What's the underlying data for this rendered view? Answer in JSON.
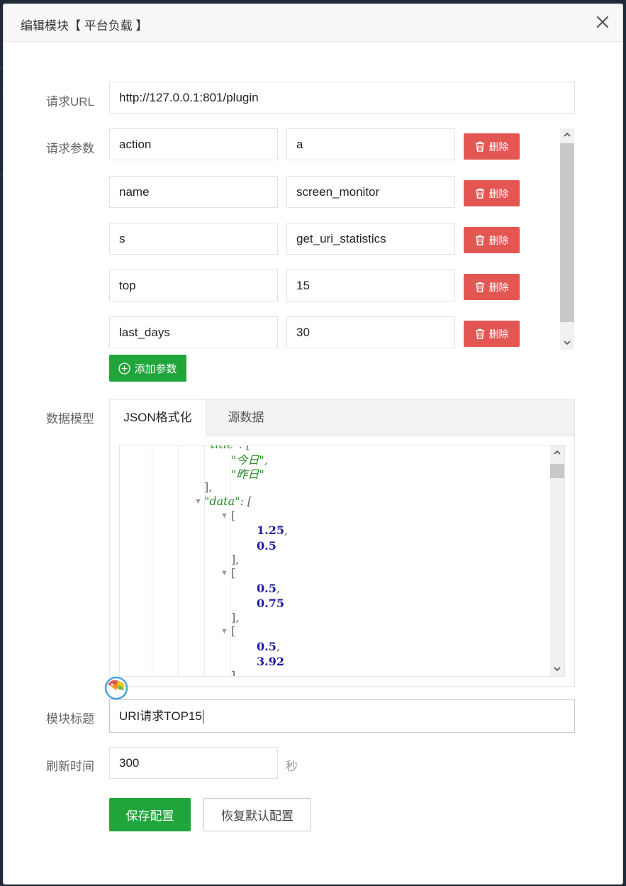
{
  "modal": {
    "title": "编辑模块【 平台负载 】",
    "close_icon": "close-icon"
  },
  "form": {
    "url_label": "请求URL",
    "url_value": "http://127.0.0.1:801/plugin",
    "params_label": "请求参数",
    "params": [
      {
        "key": "action",
        "value": "a"
      },
      {
        "key": "name",
        "value": "screen_monitor"
      },
      {
        "key": "s",
        "value": "get_uri_statistics"
      },
      {
        "key": "top",
        "value": "15"
      },
      {
        "key": "last_days",
        "value": "30"
      }
    ],
    "delete_label": "删除",
    "add_param_label": "添加参数",
    "model_label": "数据模型",
    "tabs": [
      {
        "label": "JSON格式化",
        "active": true
      },
      {
        "label": "源数据",
        "active": false
      }
    ],
    "json_lines": {
      "title_key": "title",
      "today": "\"今日\"",
      "yesterday": "\"昨日\"",
      "data_key": "\"data\"",
      "v1": "1.25",
      "v2": "0.5",
      "v3": "0.5",
      "v4": "0.75",
      "v5": "0.5",
      "v6": "3.92"
    },
    "module_title_label": "模块标题",
    "module_title_value": "URI请求TOP15",
    "refresh_label": "刷新时间",
    "refresh_value": "300",
    "refresh_unit": "秒",
    "save_label": "保存配置",
    "reset_label": "恢复默认配置"
  },
  "colors": {
    "primary": "#20a53a",
    "danger": "#e35652"
  }
}
